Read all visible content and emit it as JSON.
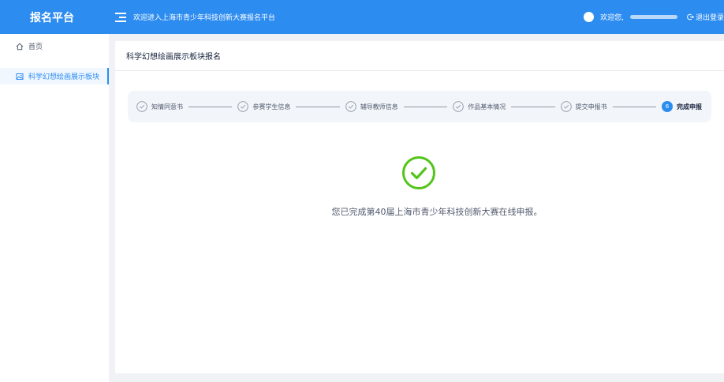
{
  "header": {
    "logo": "报名平台",
    "welcome": "欢迎进入上海市青少年科技创新大赛报名平台",
    "greeting": "欢迎您,",
    "logout": "退出登录",
    "colors": {
      "primary": "#2d8cf0"
    }
  },
  "sidebar": {
    "items": [
      {
        "label": "首页",
        "icon": "home-icon"
      },
      {
        "label": "科学幻想绘画展示板块",
        "icon": "image-icon",
        "active": true
      }
    ]
  },
  "main": {
    "title": "科学幻想绘画展示板块报名",
    "steps": [
      {
        "label": "知情同意书",
        "status": "done"
      },
      {
        "label": "参赛学生信息",
        "status": "done"
      },
      {
        "label": "辅导教师信息",
        "status": "done"
      },
      {
        "label": "作品基本情况",
        "status": "done"
      },
      {
        "label": "提交申报书",
        "status": "done"
      },
      {
        "number": "6",
        "label": "完成申报",
        "status": "current"
      }
    ],
    "success_message": "您已完成第40届上海市青少年科技创新大赛在线申报。"
  }
}
